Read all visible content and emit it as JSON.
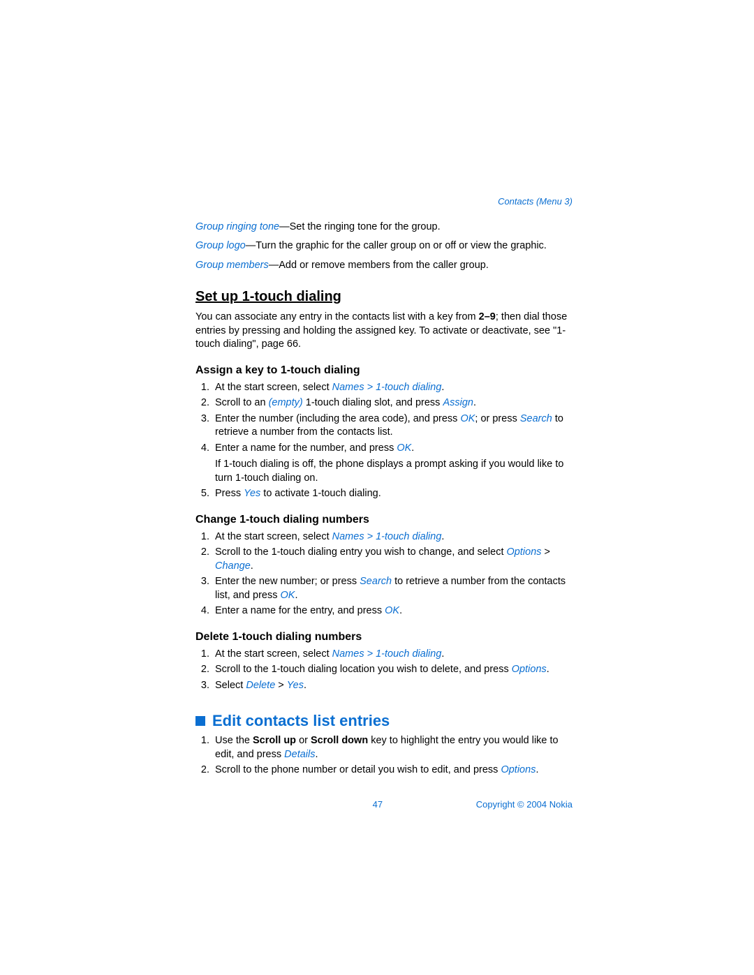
{
  "breadcrumb": "Contacts (Menu 3)",
  "defs": [
    {
      "term": "Group ringing tone",
      "desc": "—Set the ringing tone for the group."
    },
    {
      "term": "Group logo",
      "desc": "—Turn the graphic for the caller group on or off or view the graphic."
    },
    {
      "term": "Group members",
      "desc": "—Add or remove members from the caller group."
    }
  ],
  "setup": {
    "title": "Set up 1-touch dialing",
    "intro_a": "You can associate any entry in the contacts list with a key from ",
    "intro_keys": "2–9",
    "intro_b": "; then dial those entries by pressing and holding the assigned key. To activate or deactivate, see \"1-touch dialing\", page 66."
  },
  "assign": {
    "title": "Assign a key to 1-touch dialing",
    "s1_a": "At the start screen, select ",
    "s1_b": "Names > 1-touch dialing",
    "s1_c": ".",
    "s2_a": "Scroll to an ",
    "s2_b": "(empty)",
    "s2_c": " 1-touch dialing slot, and press ",
    "s2_d": "Assign",
    "s2_e": ".",
    "s3_a": "Enter the number (including the area code), and press ",
    "s3_b": "OK",
    "s3_c": "; or press ",
    "s3_d": "Search",
    "s3_e": " to retrieve a number from the contacts list.",
    "s4_a": "Enter a name for the number, and press ",
    "s4_b": "OK",
    "s4_c": ".",
    "s4_sub": "If 1-touch dialing is off, the phone displays a prompt asking if you would like to turn 1-touch dialing on.",
    "s5_a": "Press ",
    "s5_b": "Yes",
    "s5_c": " to activate 1-touch dialing."
  },
  "change": {
    "title": "Change 1-touch dialing numbers",
    "s1_a": "At the start screen, select ",
    "s1_b": "Names > 1-touch dialing",
    "s1_c": ".",
    "s2_a": "Scroll to the 1-touch dialing entry you wish to change, and select ",
    "s2_b": "Options",
    "s2_c": " > ",
    "s2_d": "Change",
    "s2_e": ".",
    "s3_a": "Enter the new number; or press ",
    "s3_b": "Search",
    "s3_c": " to retrieve a number from the contacts list, and press ",
    "s3_d": "OK",
    "s3_e": ".",
    "s4_a": "Enter a name for the entry, and press ",
    "s4_b": "OK",
    "s4_c": "."
  },
  "delete": {
    "title": "Delete 1-touch dialing numbers",
    "s1_a": "At the start screen, select ",
    "s1_b": "Names  > 1-touch dialing",
    "s1_c": ".",
    "s2_a": "Scroll to the 1-touch dialing location you wish to delete, and press ",
    "s2_b": "Options",
    "s2_c": ".",
    "s3_a": "Select ",
    "s3_b": "Delete",
    "s3_c": " > ",
    "s3_d": "Yes",
    "s3_e": "."
  },
  "edit": {
    "title": "Edit contacts list entries",
    "s1_a": "Use the ",
    "s1_b": "Scroll up",
    "s1_c": " or ",
    "s1_d": "Scroll down",
    "s1_e": " key to highlight the entry you would like to edit, and press ",
    "s1_f": "Details",
    "s1_g": ".",
    "s2_a": "Scroll to the phone number or detail you wish to edit, and press ",
    "s2_b": "Options",
    "s2_c": "."
  },
  "footer": {
    "page": "47",
    "copyright": "Copyright © 2004 Nokia"
  }
}
